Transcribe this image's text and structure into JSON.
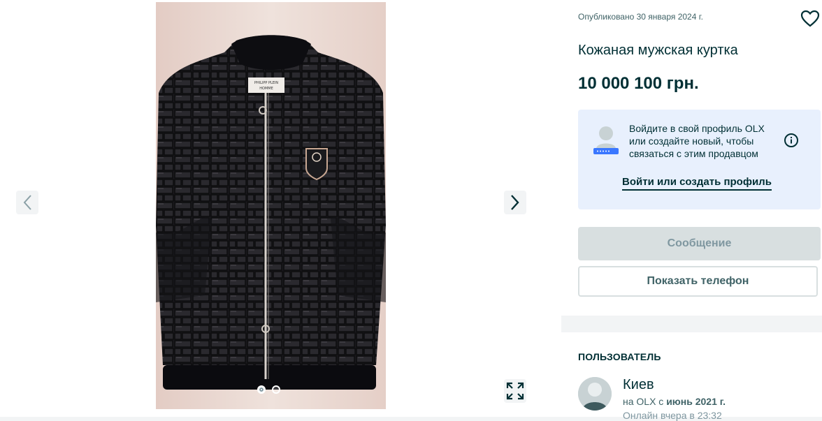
{
  "gallery": {
    "image_alt": "Кожаная мужская куртка",
    "slide_count": 2,
    "active_slide": 1,
    "photo_label_1": "PHILIPP PLEIN",
    "photo_label_2": "HOMME"
  },
  "ad": {
    "posted": "Опубликовано 30 января 2024 г.",
    "title": "Кожаная мужская куртка",
    "price": "10 000 100 грн."
  },
  "login_prompt": {
    "text": "Войдите в свой профиль OLX или создайте новый, чтобы связаться с этим продавцом",
    "link": "Войти или создать профиль"
  },
  "actions": {
    "message": "Сообщение",
    "show_phone": "Показать телефон"
  },
  "user": {
    "heading": "ПОЛЬЗОВАТЕЛЬ",
    "name": "Киев",
    "since_prefix": "на OLX с ",
    "since_date": "июнь 2021 г.",
    "online": "Онлайн вчера в 23:32"
  },
  "colors": {
    "text_primary": "#002f34",
    "login_bg": "#e8f0fd",
    "disabled_btn": "#d8dfe0"
  },
  "icons": [
    "chevron-left-icon",
    "chevron-right-icon",
    "expand-icon",
    "heart-icon",
    "info-icon",
    "user-avatar-icon"
  ]
}
